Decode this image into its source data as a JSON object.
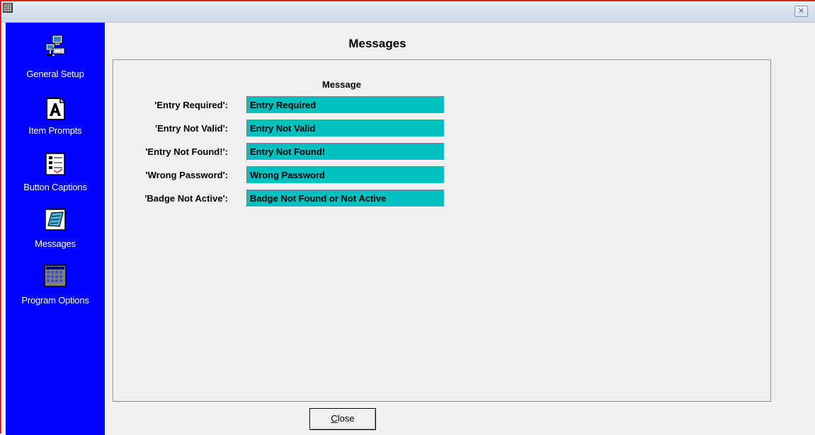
{
  "titlebar": {
    "close_glyph": "✕"
  },
  "sidebar": {
    "background": "#0000ff",
    "items": [
      {
        "label": "General Setup",
        "icon": "computer-network-icon"
      },
      {
        "label": "Item Prompts",
        "icon": "letter-a-document-icon"
      },
      {
        "label": "Button Captions",
        "icon": "checklist-icon"
      },
      {
        "label": "Messages",
        "icon": "notepad-icon"
      },
      {
        "label": "Program Options",
        "icon": "calendar-grid-icon"
      }
    ]
  },
  "main": {
    "title": "Messages",
    "column_header": "Message",
    "field_color": "#00c0c0",
    "rows": [
      {
        "label": "'Entry Required':",
        "value": "Entry Required"
      },
      {
        "label": "'Entry Not Valid':",
        "value": "Entry Not Valid"
      },
      {
        "label": "'Entry Not Found!':",
        "value": "Entry Not Found!"
      },
      {
        "label": "'Wrong Password':",
        "value": "Wrong Password"
      },
      {
        "label": "'Badge Not Active':",
        "value": "Badge Not Found or Not Active"
      }
    ]
  },
  "footer": {
    "close_accel": "C",
    "close_rest": "lose"
  }
}
